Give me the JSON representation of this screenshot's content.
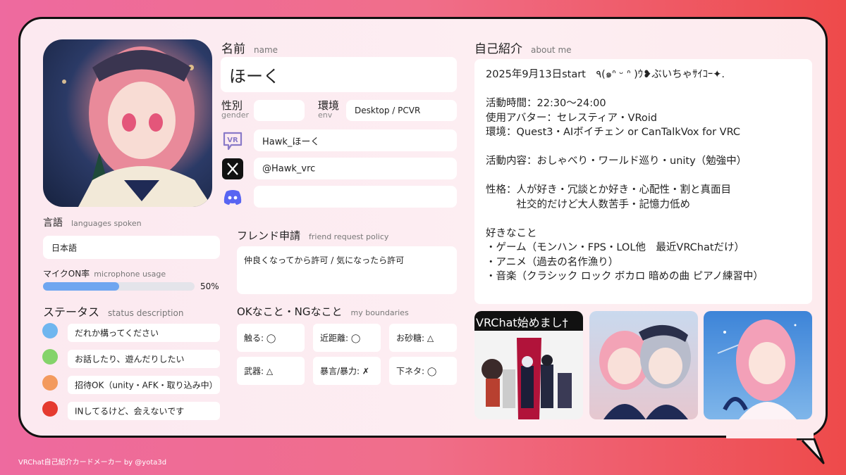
{
  "name": {
    "label": "名前",
    "label_en": "name",
    "value": "ほーく"
  },
  "gender": {
    "label": "性別",
    "label_en": "gender",
    "value": ""
  },
  "env": {
    "label": "環境",
    "label_en": "env",
    "value": "Desktop / PCVR"
  },
  "accounts": {
    "vrchat": {
      "icon": "vrchat-icon",
      "value": "Hawk_ほーく"
    },
    "x": {
      "icon": "x-icon",
      "value": "@Hawk_vrc"
    },
    "discord": {
      "icon": "discord-icon",
      "value": ""
    }
  },
  "languages": {
    "label": "言語",
    "label_en": "languages spoken",
    "value": "日本語"
  },
  "mic": {
    "label": "マイクON率",
    "label_en": "microphone usage",
    "percent": 50,
    "percent_text": "50%"
  },
  "status": {
    "label": "ステータス",
    "label_en": "status description",
    "items": [
      {
        "color": "#6fb6ef",
        "text": "だれか構ってください"
      },
      {
        "color": "#84d36a",
        "text": "お話したり、遊んだりしたい"
      },
      {
        "color": "#f39a5e",
        "text": "招待OK（unity・AFK・取り込み中）"
      },
      {
        "color": "#e53a2f",
        "text": "INしてるけど、会えないです"
      }
    ]
  },
  "friend_request": {
    "label": "フレンド申請",
    "label_en": "friend request policy",
    "value": "仲良くなってから許可 / 気になったら許可"
  },
  "boundaries": {
    "label": "OKなこと・NGなこと",
    "label_en": "my boundaries",
    "items": [
      "触る: ◯",
      "近距離: ◯",
      "お砂糖: △",
      "武器: △",
      "暴言/暴力: ✗",
      "下ネタ: ◯"
    ]
  },
  "about": {
    "label": "自己紹介",
    "label_en": "about me",
    "lines": [
      "2025年9月13日start　٩(๑ᐢ ᵕ ᐢ )ｳ❥ぶいちゃｻｲｺｰ✦.",
      "",
      "活動時間：22:30〜24:00",
      "使用アバター：セレスティア・VRoid",
      "環境：Quest3・AIボイチェン or CanTalkVox for VRC",
      "",
      "活動内容：おしゃべり・ワールド巡り・unity（勉強中）",
      "",
      "性格：人が好き・冗談とか好き・心配性・割と真面目",
      "　　　社交的だけど大人数苦手・記憶力低め",
      "",
      "好きなこと",
      "・ゲーム（モンハン・FPS・LOL他　最近VRChatだけ）",
      "・アニメ（過去の名作漁り）",
      "・音楽（クラシック ロック ボカロ 暗めの曲 ピアノ練習中）"
    ]
  },
  "photos": {
    "caption": "VRChat始めまし†"
  },
  "footer": "VRChat自己紹介カードメーカー by @yota3d",
  "colors": {
    "mic_bar": "#6fa6f0",
    "mic_track": "#e4e4ea",
    "vrchat": "#8a7ac8",
    "discord": "#5865f2"
  }
}
